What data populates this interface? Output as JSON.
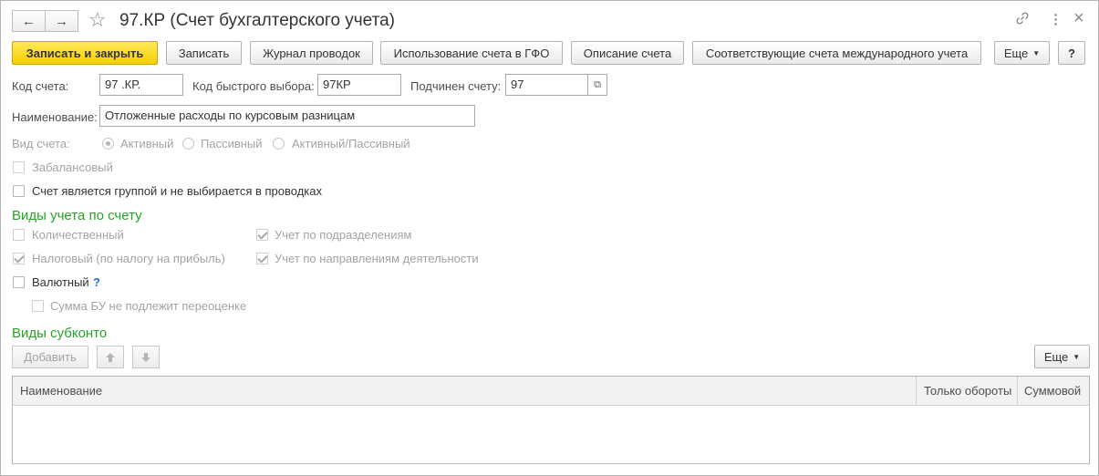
{
  "header": {
    "title": "97.КР (Счет бухгалтерского учета)",
    "back_icon": "←",
    "forward_icon": "→",
    "star_icon": "☆",
    "link_icon": "🔗",
    "more_icon": "⋮",
    "close_icon": "×"
  },
  "toolbar": {
    "save_close": "Записать и закрыть",
    "save": "Записать",
    "journal": "Журнал проводок",
    "gfo": "Использование счета в ГФО",
    "description": "Описание счета",
    "intl": "Соответствующие счета международного учета",
    "more": "Еще",
    "help": "?"
  },
  "form": {
    "code_label": "Код счета:",
    "code_value": "97 .КР.",
    "quick_label": "Код быстрого выбора:",
    "quick_value": "97КР",
    "parent_label": "Подчинен счету:",
    "parent_value": "97",
    "name_label": "Наименование:",
    "name_value": "Отложенные расходы по курсовым разницам",
    "type_label": "Вид счета:",
    "type_options": [
      "Активный",
      "Пассивный",
      "Активный/Пассивный"
    ],
    "offbalance_label": "Забалансовый",
    "group_label": "Счет является группой и не выбирается в проводках"
  },
  "accounting_types": {
    "title": "Виды учета по счету",
    "quantitative": "Количественный",
    "tax": "Налоговый (по налогу на прибыль)",
    "currency": "Валютный",
    "currency_help": "?",
    "no_revaluation": "Сумма БУ не подлежит переоценке",
    "by_division": "Учет по подразделениям",
    "by_activity": "Учет по направлениям деятельности"
  },
  "subconto": {
    "title": "Виды субконто",
    "add": "Добавить",
    "up_icon": "🡅",
    "down_icon": "🡇",
    "more": "Еще",
    "columns": [
      "Наименование",
      "Только обороты",
      "Суммовой"
    ]
  }
}
